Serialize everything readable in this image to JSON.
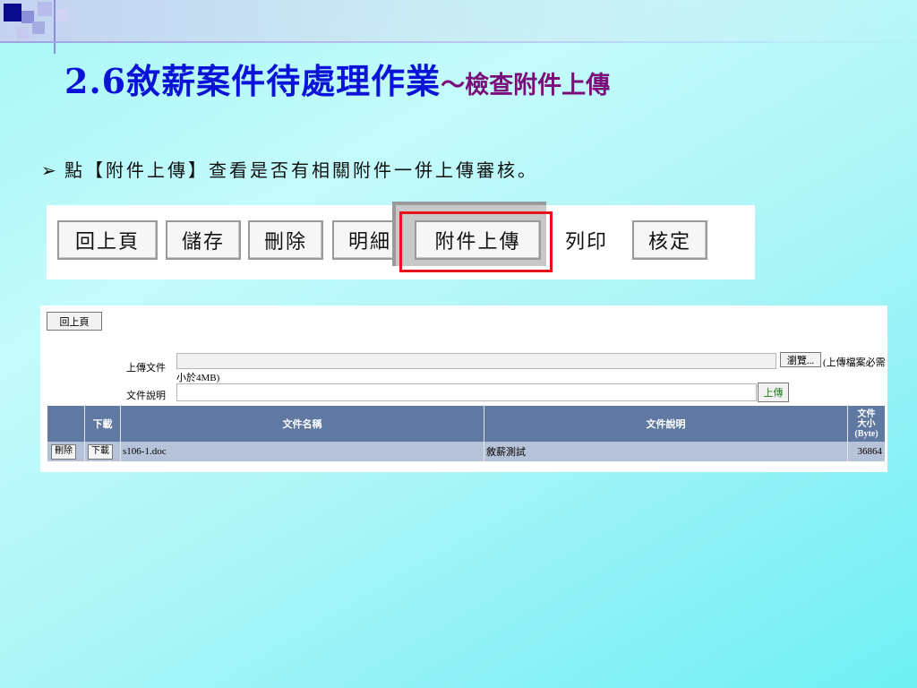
{
  "slide": {
    "title_main": "2.6敘薪案件待處理作業",
    "title_sub": "～檢查附件上傳",
    "bullet_text": "點【附件上傳】查看是否有相關附件一併上傳審核。"
  },
  "toolbar": {
    "buttons": [
      "回上頁",
      "儲存",
      "刪除",
      "明細",
      "附件上傳",
      "列印",
      "核定"
    ],
    "highlighted": "附件上傳"
  },
  "upload_form": {
    "back_button": "回上頁",
    "upload_file_label": "上傳文件",
    "browse_button": "瀏覽...",
    "size_note_part1": "(上傳檔案必需",
    "size_note_part2": "小於4MB)",
    "description_label": "文件說明",
    "upload_button": "上傳"
  },
  "attachments_table": {
    "columns": [
      "",
      "下載",
      "文件名稱",
      "文件說明",
      "文件大小(Byte)"
    ],
    "size_header_lines": [
      "文件",
      "大小",
      "(Byte)"
    ],
    "rows": [
      {
        "delete_label": "刪除",
        "download_label": "下載",
        "file_name": "s106-1.doc",
        "description": "敘薪測試",
        "size": "36864"
      }
    ]
  },
  "colors": {
    "title_blue": "#0b13d6",
    "subtitle_purple": "#7a0d7a",
    "highlight_red": "#e8121a",
    "table_header": "#5f79a3",
    "table_row": "#b5c2d8"
  }
}
